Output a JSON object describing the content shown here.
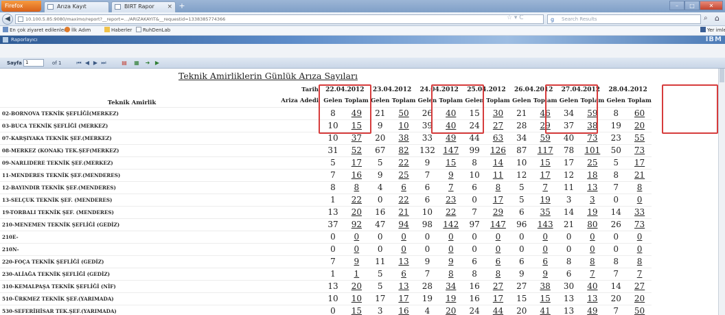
{
  "browser": {
    "app_button": "Firefox",
    "tabs": [
      {
        "label": "Arıza Kayıt"
      },
      {
        "label": "BIRT Rapor Görüntüleyici"
      }
    ],
    "url": "10.100.5.85:9080/maximo/report?__report=.../ARIZAKAYIT&__requestid=1338385774366",
    "search_placeholder": "Search Results",
    "bookmarks": [
      "En çok ziyaret edilenler",
      "İlk Adım",
      "Haberler",
      "RuhDenLab"
    ],
    "bookmarks_right": "Yer imle"
  },
  "viewer": {
    "title": "Raporlayıcı",
    "brand": "IBM",
    "page_label": "Sayfa",
    "page_value": "1",
    "page_of": "of 1"
  },
  "report": {
    "title": "Teknik Amirliklerin Günlük Arıza Sayıları",
    "row_header": "Teknik Amirlik",
    "date_label": "Tarih",
    "count_label": "Ariza Adedi",
    "col_incoming": "Gelen",
    "col_total": "Toplam",
    "dates": [
      "22.04.2012",
      "23.04.2012",
      "24.04.2012",
      "25.04.2012",
      "26.04.2012",
      "27.04.2012",
      "28.04.2012"
    ],
    "rows": [
      {
        "name": "02-BORNOVA TEKNİK ŞEFLİĞİ(MERKEZ)",
        "values": [
          [
            "8",
            "49"
          ],
          [
            "21",
            "50"
          ],
          [
            "26",
            "40"
          ],
          [
            "15",
            "30"
          ],
          [
            "21",
            "46"
          ],
          [
            "34",
            "59"
          ],
          [
            "8",
            "60"
          ]
        ]
      },
      {
        "name": "03-BUCA TEKNİK ŞEFLİĞİ (MERKEZ)",
        "values": [
          [
            "10",
            "15"
          ],
          [
            "9",
            "10"
          ],
          [
            "39",
            "40"
          ],
          [
            "24",
            "27"
          ],
          [
            "28",
            "29"
          ],
          [
            "37",
            "38"
          ],
          [
            "19",
            "20"
          ]
        ]
      },
      {
        "name": "07-KARŞIYAKA TEKNİK ŞEF.(MERKEZ)",
        "values": [
          [
            "10",
            "37"
          ],
          [
            "20",
            "38"
          ],
          [
            "33",
            "49"
          ],
          [
            "44",
            "63"
          ],
          [
            "34",
            "59"
          ],
          [
            "40",
            "73"
          ],
          [
            "23",
            "55"
          ]
        ]
      },
      {
        "name": "08-MERKEZ (KONAK) TEK.ŞEF(MERKEZ)",
        "values": [
          [
            "31",
            "52"
          ],
          [
            "67",
            "82"
          ],
          [
            "132",
            "147"
          ],
          [
            "99",
            "126"
          ],
          [
            "87",
            "117"
          ],
          [
            "78",
            "101"
          ],
          [
            "50",
            "73"
          ]
        ]
      },
      {
        "name": "09-NARLIDERE TEKNİK ŞEF.(MERKEZ)",
        "values": [
          [
            "5",
            "17"
          ],
          [
            "5",
            "22"
          ],
          [
            "9",
            "15"
          ],
          [
            "8",
            "14"
          ],
          [
            "10",
            "15"
          ],
          [
            "17",
            "25"
          ],
          [
            "5",
            "17"
          ]
        ]
      },
      {
        "name": "11-MENDERES TEKNİK ŞEF.(MENDERES)",
        "values": [
          [
            "7",
            "16"
          ],
          [
            "9",
            "25"
          ],
          [
            "7",
            "9"
          ],
          [
            "10",
            "11"
          ],
          [
            "12",
            "17"
          ],
          [
            "12",
            "18"
          ],
          [
            "8",
            "21"
          ]
        ]
      },
      {
        "name": "12-BAYINDIR TEKNİK ŞEF.(MENDERES)",
        "values": [
          [
            "8",
            "8"
          ],
          [
            "4",
            "6"
          ],
          [
            "6",
            "7"
          ],
          [
            "6",
            "8"
          ],
          [
            "5",
            "7"
          ],
          [
            "11",
            "13"
          ],
          [
            "7",
            "8"
          ]
        ]
      },
      {
        "name": "13-SELÇUK TEKNİK ŞEF. (MENDERES)",
        "values": [
          [
            "1",
            "22"
          ],
          [
            "0",
            "22"
          ],
          [
            "6",
            "23"
          ],
          [
            "0",
            "17"
          ],
          [
            "5",
            "19"
          ],
          [
            "3",
            "3"
          ],
          [
            "0",
            "0"
          ]
        ]
      },
      {
        "name": "19-TORBALI TEKNİK ŞEF. (MENDERES)",
        "values": [
          [
            "13",
            "20"
          ],
          [
            "16",
            "21"
          ],
          [
            "10",
            "22"
          ],
          [
            "7",
            "29"
          ],
          [
            "6",
            "35"
          ],
          [
            "14",
            "19"
          ],
          [
            "14",
            "33"
          ]
        ]
      },
      {
        "name": "210-MENEMEN TEKNİK ŞEFLİĞİ (GEDİZ)",
        "values": [
          [
            "37",
            "92"
          ],
          [
            "47",
            "94"
          ],
          [
            "98",
            "142"
          ],
          [
            "97",
            "147"
          ],
          [
            "96",
            "143"
          ],
          [
            "21",
            "80"
          ],
          [
            "26",
            "73"
          ]
        ]
      },
      {
        "name": "210E-",
        "values": [
          [
            "0",
            "0"
          ],
          [
            "0",
            "0"
          ],
          [
            "0",
            "0"
          ],
          [
            "0",
            "0"
          ],
          [
            "0",
            "0"
          ],
          [
            "0",
            "0"
          ],
          [
            "0",
            "0"
          ]
        ]
      },
      {
        "name": "210N-",
        "values": [
          [
            "0",
            "0"
          ],
          [
            "0",
            "0"
          ],
          [
            "0",
            "0"
          ],
          [
            "0",
            "0"
          ],
          [
            "0",
            "0"
          ],
          [
            "0",
            "0"
          ],
          [
            "0",
            "0"
          ]
        ]
      },
      {
        "name": "220-FOÇA TEKNİK ŞEFLİĞİ (GEDİZ)",
        "values": [
          [
            "7",
            "9"
          ],
          [
            "11",
            "13"
          ],
          [
            "9",
            "9"
          ],
          [
            "6",
            "6"
          ],
          [
            "6",
            "6"
          ],
          [
            "8",
            "8"
          ],
          [
            "8",
            "8"
          ]
        ]
      },
      {
        "name": "230-ALİAĞA TEKNİK ŞEFLİĞİ (GEDİZ)",
        "values": [
          [
            "1",
            "1"
          ],
          [
            "5",
            "6"
          ],
          [
            "7",
            "8"
          ],
          [
            "8",
            "8"
          ],
          [
            "9",
            "9"
          ],
          [
            "6",
            "7"
          ],
          [
            "7",
            "7"
          ]
        ]
      },
      {
        "name": "310-KEMALPAŞA TEKNİK ŞEFLİĞİ (NİF)",
        "values": [
          [
            "13",
            "20"
          ],
          [
            "5",
            "13"
          ],
          [
            "28",
            "34"
          ],
          [
            "16",
            "27"
          ],
          [
            "27",
            "38"
          ],
          [
            "30",
            "40"
          ],
          [
            "14",
            "27"
          ]
        ]
      },
      {
        "name": "510-ÜRKMEZ TEKNİK ŞEF.(YARIMADA)",
        "values": [
          [
            "10",
            "10"
          ],
          [
            "17",
            "17"
          ],
          [
            "19",
            "19"
          ],
          [
            "16",
            "17"
          ],
          [
            "15",
            "15"
          ],
          [
            "13",
            "13"
          ],
          [
            "20",
            "20"
          ]
        ]
      },
      {
        "name": "530-SEFERİHİSAR TEK.ŞEF.(YARIMADA)",
        "values": [
          [
            "0",
            "15"
          ],
          [
            "3",
            "16"
          ],
          [
            "4",
            "20"
          ],
          [
            "24",
            "44"
          ],
          [
            "20",
            "41"
          ],
          [
            "13",
            "49"
          ],
          [
            "7",
            "50"
          ]
        ]
      }
    ]
  },
  "colors": {
    "highlight": "#d63b3b",
    "banner": "#2f5b95"
  }
}
